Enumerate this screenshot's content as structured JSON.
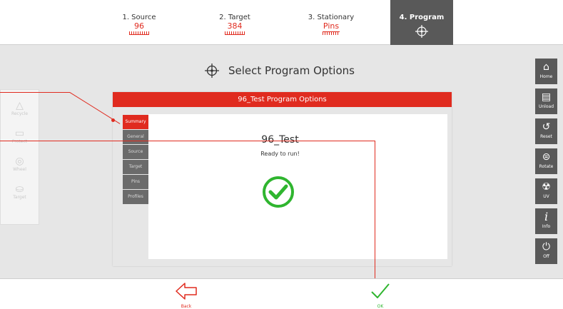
{
  "steps": [
    {
      "label": "1. Source",
      "value": "96",
      "icon": "plate-96-icon"
    },
    {
      "label": "2. Target",
      "value": "384",
      "icon": "plate-384-icon"
    },
    {
      "label": "3. Stationary",
      "value": "Pins",
      "icon": "pins-icon"
    },
    {
      "label": "4. Program",
      "value": "",
      "icon": "crosshair-icon"
    }
  ],
  "left_panel": {
    "items": [
      {
        "label": "Recycle",
        "icon": "recycle-icon"
      },
      {
        "label": "Protect",
        "icon": "protect-icon"
      },
      {
        "label": "Wheel",
        "icon": "wheel-icon"
      },
      {
        "label": "Target",
        "icon": "target-icon"
      }
    ]
  },
  "tools": [
    {
      "label": "Home",
      "icon": "home-icon"
    },
    {
      "label": "Unload",
      "icon": "unload-icon"
    },
    {
      "label": "Reset",
      "icon": "reset-icon"
    },
    {
      "label": "Rotate",
      "icon": "rotate-icon"
    },
    {
      "label": "UV",
      "icon": "uv-icon"
    },
    {
      "label": "Info",
      "icon": "info-icon"
    },
    {
      "label": "Off",
      "icon": "power-icon"
    }
  ],
  "title": "Select Program Options",
  "dialog": {
    "header": "96_Test Program Options",
    "tabs": [
      "Summary",
      "General",
      "Source",
      "Target",
      "Pins",
      "Profiles"
    ],
    "active_tab": "Summary",
    "program_name": "96_Test",
    "status": "Ready to run!"
  },
  "bottom": {
    "back_label": "Back",
    "ok_label": "OK"
  },
  "colors": {
    "accent": "#e02b1f",
    "success": "#2fb52f",
    "dark": "#595959"
  }
}
